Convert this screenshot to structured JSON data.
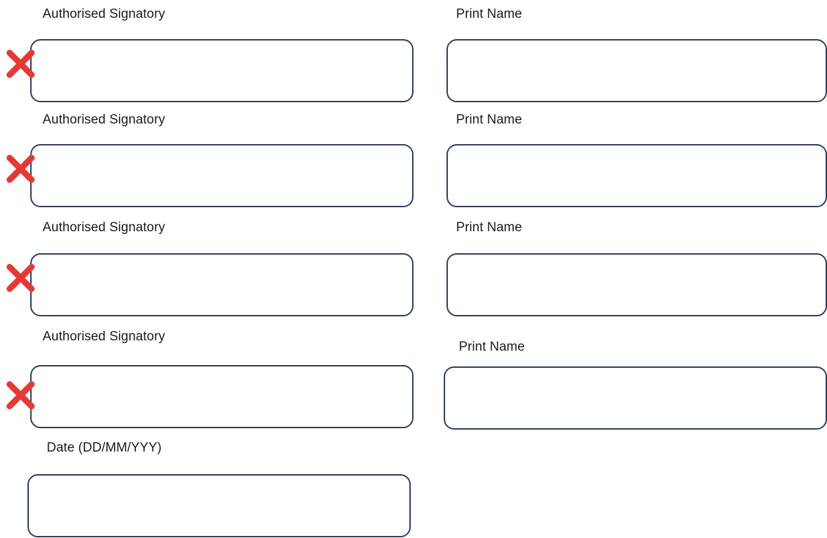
{
  "rows": [
    {
      "signatory_label": "Authorised Signatory",
      "print_name_label": "Print Name",
      "signatory_value": "",
      "print_name_value": "",
      "sign_here_icon": "red-cross-icon"
    },
    {
      "signatory_label": "Authorised Signatory",
      "print_name_label": "Print Name",
      "signatory_value": "",
      "print_name_value": "",
      "sign_here_icon": "red-cross-icon"
    },
    {
      "signatory_label": "Authorised Signatory",
      "print_name_label": "Print Name",
      "signatory_value": "",
      "print_name_value": "",
      "sign_here_icon": "red-cross-icon"
    },
    {
      "signatory_label": "Authorised Signatory",
      "print_name_label": "Print Name",
      "signatory_value": "",
      "print_name_value": "",
      "sign_here_icon": "red-cross-icon"
    }
  ],
  "date": {
    "label": "Date (DD/MM/YYY)",
    "value": ""
  },
  "colors": {
    "field_border": "#2e3b5e",
    "cross": "#e53935"
  }
}
